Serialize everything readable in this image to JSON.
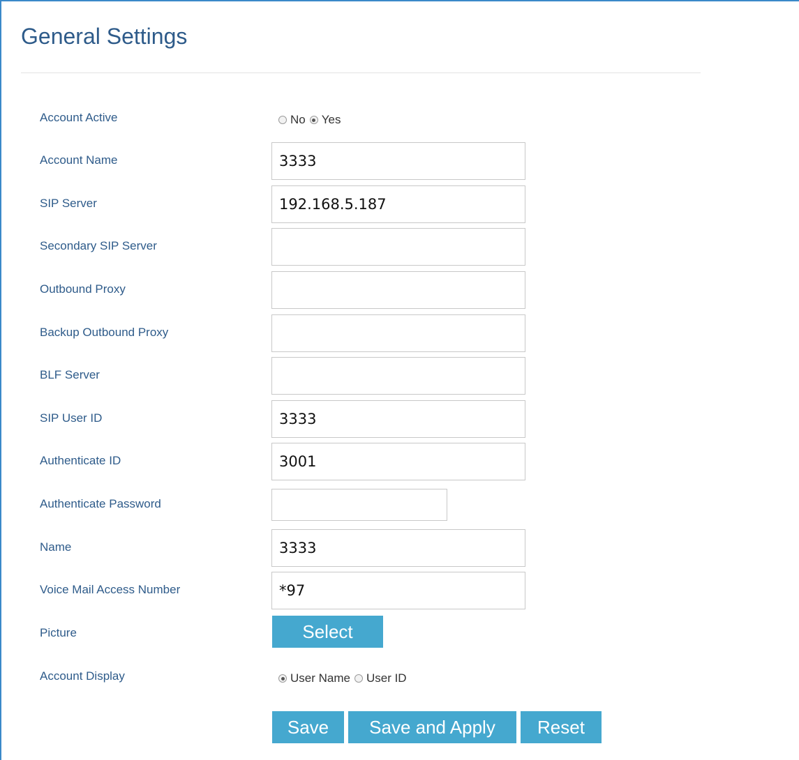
{
  "page": {
    "title": "General Settings"
  },
  "fields": {
    "account_active": {
      "label": "Account Active",
      "options": [
        "No",
        "Yes"
      ],
      "selected": "Yes"
    },
    "account_name": {
      "label": "Account Name",
      "value": "3333"
    },
    "sip_server": {
      "label": "SIP Server",
      "value": "192.168.5.187"
    },
    "secondary_sip_server": {
      "label": "Secondary SIP Server",
      "value": ""
    },
    "outbound_proxy": {
      "label": "Outbound Proxy",
      "value": ""
    },
    "backup_outbound_proxy": {
      "label": "Backup Outbound Proxy",
      "value": ""
    },
    "blf_server": {
      "label": "BLF Server",
      "value": ""
    },
    "sip_user_id": {
      "label": "SIP User ID",
      "value": "3333"
    },
    "authenticate_id": {
      "label": "Authenticate ID",
      "value": "3001"
    },
    "authenticate_password": {
      "label": "Authenticate Password",
      "value": ""
    },
    "name": {
      "label": "Name",
      "value": "3333"
    },
    "voice_mail_access_number": {
      "label": "Voice Mail Access Number",
      "value": "*97"
    },
    "picture": {
      "label": "Picture",
      "button": "Select"
    },
    "account_display": {
      "label": "Account Display",
      "options": [
        "User Name",
        "User ID"
      ],
      "selected": "User Name"
    }
  },
  "actions": {
    "save": "Save",
    "save_and_apply": "Save and Apply",
    "reset": "Reset"
  },
  "colors": {
    "title": "#2e5b8a",
    "label": "#2e5b8a",
    "button_bg": "#45a8cf",
    "button_text": "#ffffff",
    "frame_border": "#3a89c9"
  }
}
